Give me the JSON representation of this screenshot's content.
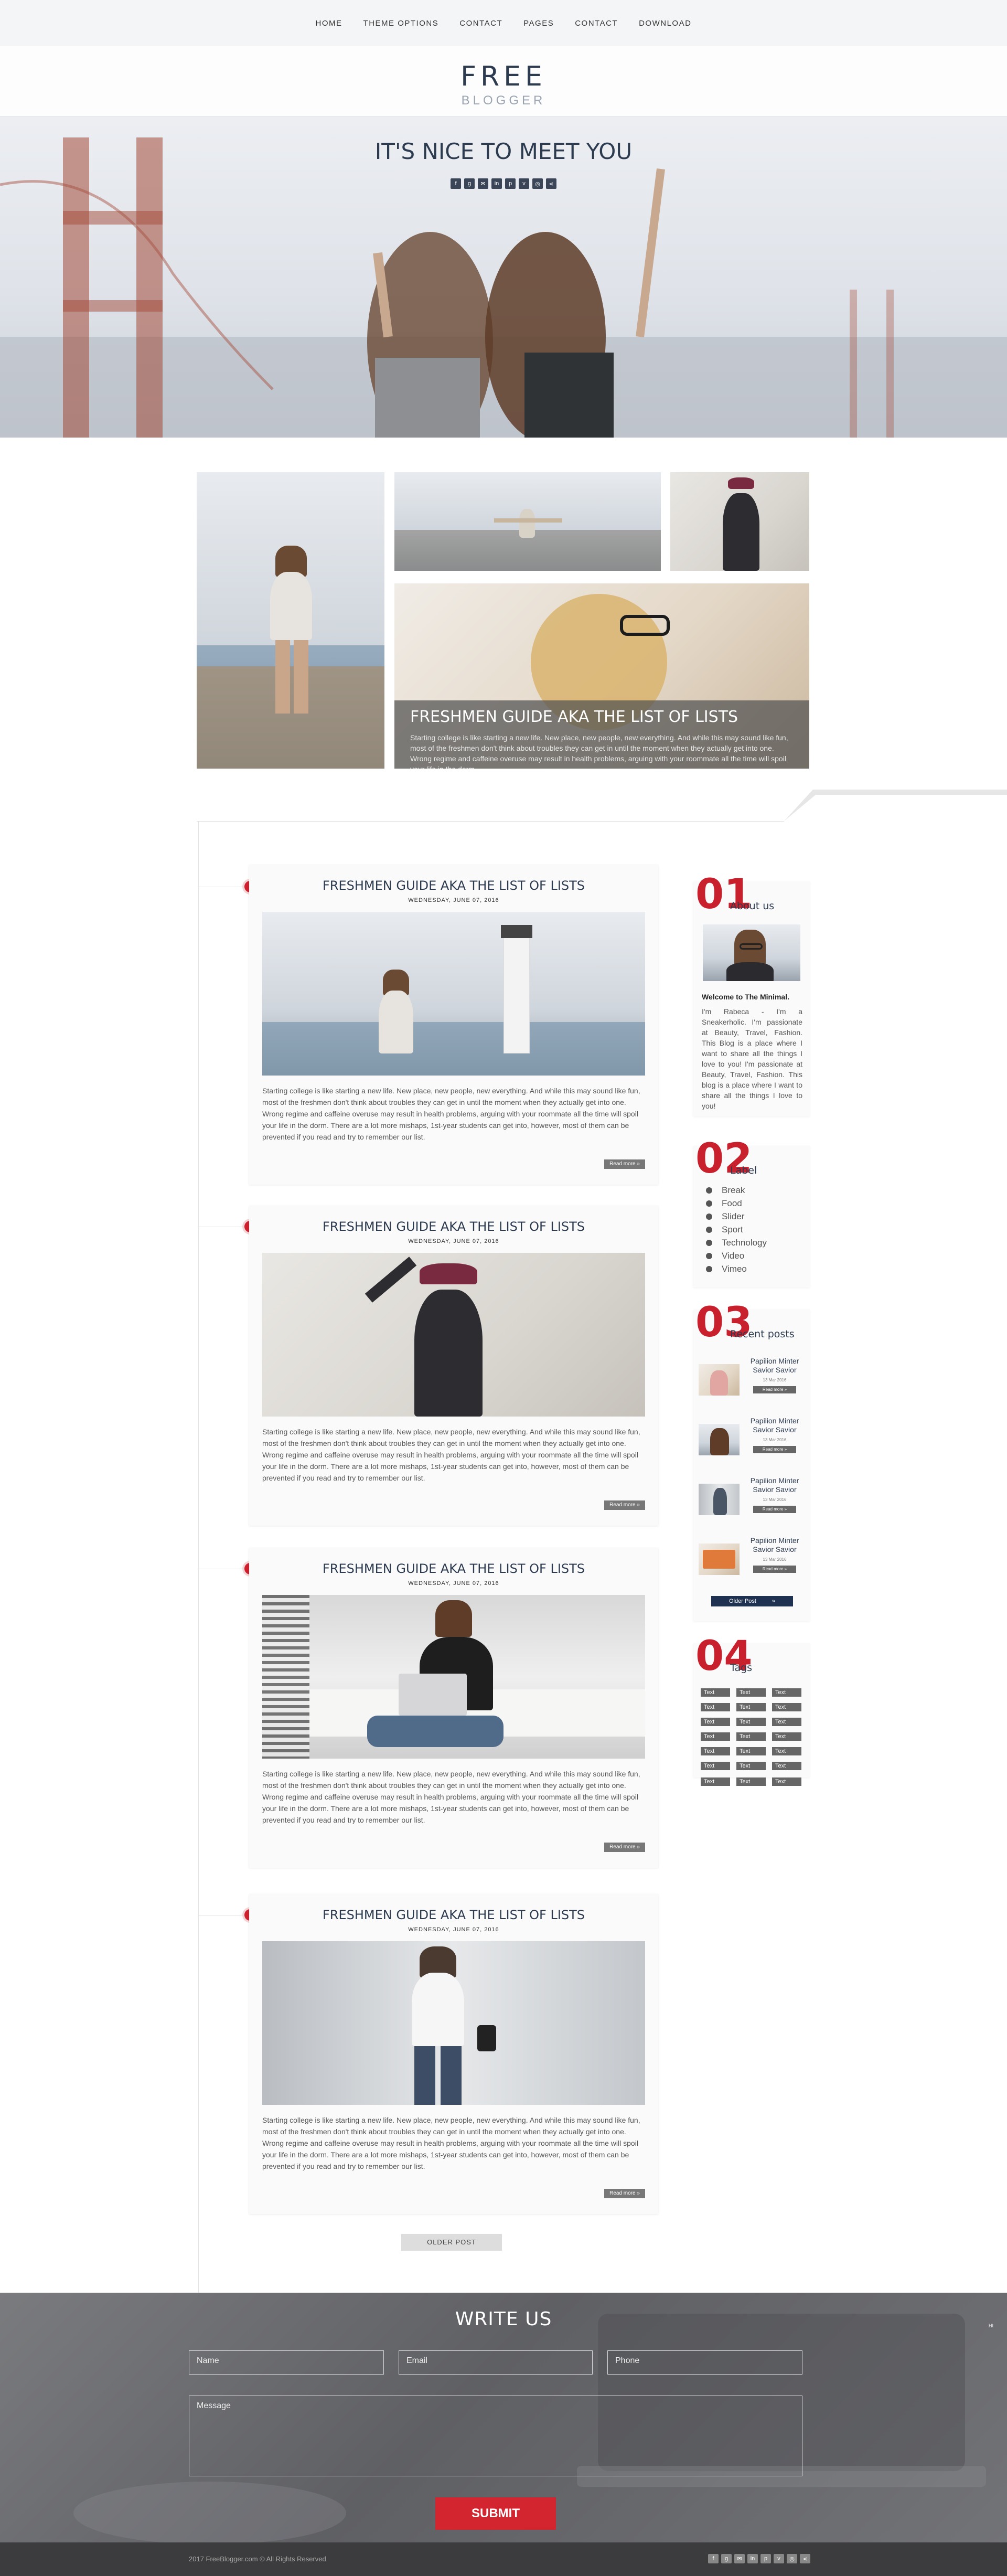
{
  "nav": {
    "items": [
      "HOME",
      "THEME OPTIONS",
      "CONTACT",
      "PAGES",
      "CONTACT",
      "DOWNLOAD"
    ]
  },
  "logo": {
    "main": "FREE",
    "sub": "BLOGGER"
  },
  "hero": {
    "title": "IT'S NICE TO MEET YOU",
    "social_icons": [
      "facebook-icon",
      "google-plus-icon",
      "email-icon",
      "linkedin-icon",
      "pinterest-icon",
      "vimeo-icon",
      "rss-icon",
      "share-icon"
    ]
  },
  "featured": {
    "caption_title": "FRESHMEN GUIDE AKA THE LIST OF LISTS",
    "caption_text": "Starting college is like starting a new life. New place, new people, new everything. And while this may sound like fun, most of the freshmen don't think about troubles they can get in until the moment when they actually get into one. Wrong regime and caffeine overuse may result in health problems, arguing with your roommate all the time will spoil your life in the dorm."
  },
  "posts": [
    {
      "title": "FRESHMEN GUIDE AKA THE LIST OF LISTS",
      "date": "WEDNESDAY, JUNE 07, 2016",
      "excerpt": "Starting college is like starting a new life. New place, new people, new everything. And while this may sound like fun, most of the freshmen don't think about troubles they can get in until the moment when they actually get into one. Wrong regime and caffeine overuse may result in health problems, arguing with your roommate all the time will spoil your life in the dorm. There are a lot more mishaps, 1st-year students can get into, however, most of them can be prevented if you read and try to remember our list.",
      "read_more": "Read more »"
    },
    {
      "title": "FRESHMEN GUIDE AKA THE LIST OF LISTS",
      "date": "WEDNESDAY, JUNE 07, 2016",
      "excerpt": "Starting college is like starting a new life. New place, new people, new everything. And while this may sound like fun, most of the freshmen don't think about troubles they can get in until the moment when they actually get into one. Wrong regime and caffeine overuse may result in health problems, arguing with your roommate all the time will spoil your life in the dorm. There are a lot more mishaps, 1st-year students can get into, however, most of them can be prevented if you read and try to remember our list.",
      "read_more": "Read more »"
    },
    {
      "title": "FRESHMEN GUIDE AKA THE LIST OF LISTS",
      "date": "WEDNESDAY, JUNE 07, 2016",
      "excerpt": "Starting college is like starting a new life. New place, new people, new everything. And while this may sound like fun, most of the freshmen don't think about troubles they can get in until the moment when they actually get into one. Wrong regime and caffeine overuse may result in health problems, arguing with your roommate all the time will spoil your life in the dorm. There are a lot more mishaps, 1st-year students can get into, however, most of them can be prevented if you read and try to remember our list.",
      "read_more": "Read more »"
    },
    {
      "title": "FRESHMEN GUIDE AKA THE LIST OF LISTS",
      "date": "WEDNESDAY, JUNE 07, 2016",
      "excerpt": "Starting college is like starting a new life. New place, new people, new everything. And while this may sound like fun, most of the freshmen don't think about troubles they can get in until the moment when they actually get into one. Wrong regime and caffeine overuse may result in health problems, arguing with your roommate all the time will spoil your life in the dorm. There are a lot more mishaps, 1st-year students can get into, however, most of them can be prevented if you read and try to remember our list.",
      "read_more": "Read more »"
    }
  ],
  "older_post": "OLDER POST",
  "sidebar": {
    "about": {
      "num": "01",
      "title": "About us",
      "heading": "Welcome to The Minimal.",
      "text": "I'm Rabeca - I'm a Sneakerholic. I'm passionate at Beauty, Travel, Fashion. This Blog is a place where I want to share all the things I love to you! I'm passionate at Beauty, Travel, Fashion. This blog is a place where I want to share all the things I love to you!"
    },
    "labels": {
      "num": "02",
      "title": "Label",
      "items": [
        "Break",
        "Food",
        "Slider",
        "Sport",
        "Technology",
        "Video",
        "Vimeo"
      ]
    },
    "recent": {
      "num": "03",
      "title": "Recent posts",
      "items": [
        {
          "title": "Papilion Minter Savior Savior",
          "date": "13 Mar 2016",
          "button": "Read more »"
        },
        {
          "title": "Papilion Minter Savior Savior",
          "date": "13 Mar 2016",
          "button": "Read more »"
        },
        {
          "title": "Papilion Minter Savior Savior",
          "date": "13 Mar 2016",
          "button": "Read more »"
        },
        {
          "title": "Papilion Minter Savior Savior",
          "date": "13 Mar 2016",
          "button": "Read more »"
        }
      ],
      "older": "Older Post",
      "older_arrow": "»"
    },
    "tags": {
      "num": "04",
      "title": "Tags",
      "items": [
        "Text",
        "Text",
        "Text",
        "Text",
        "Text",
        "Text",
        "Text",
        "Text",
        "Text",
        "Text",
        "Text",
        "Text",
        "Text",
        "Text",
        "Text",
        "Text",
        "Text",
        "Text",
        "Text",
        "Text",
        "Text"
      ]
    }
  },
  "write_us": {
    "title": "WRITE US",
    "name_placeholder": "Name",
    "email_placeholder": "Email",
    "phone_placeholder": "Phone",
    "message_placeholder": "Message",
    "submit": "SUBMIT",
    "side_note": "HI"
  },
  "footer": {
    "copyright": "2017 FreeBlogger.com  ©  All Rights Reserved",
    "social_icons": [
      "facebook-icon",
      "google-plus-icon",
      "email-icon",
      "linkedin-icon",
      "pinterest-icon",
      "vimeo-icon",
      "rss-icon",
      "share-icon"
    ]
  }
}
